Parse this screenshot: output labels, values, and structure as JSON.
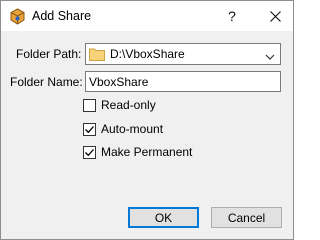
{
  "window": {
    "title": "Add Share",
    "help_glyph": "?",
    "icons": {
      "app": "virtualbox-app-icon",
      "close": "close-icon"
    }
  },
  "form": {
    "folder_path": {
      "label": "Folder Path:",
      "value": "D:\\VboxShare",
      "icon": "folder-icon"
    },
    "folder_name": {
      "label": "Folder Name:",
      "value": "VboxShare"
    },
    "options": [
      {
        "label": "Read-only",
        "checked": false
      },
      {
        "label": "Auto-mount",
        "checked": true
      },
      {
        "label": "Make Permanent",
        "checked": true
      }
    ]
  },
  "buttons": {
    "ok": "OK",
    "cancel": "Cancel"
  },
  "colors": {
    "dialog_bg": "#f0f0f0",
    "title_bg": "#ffffff",
    "default_button_border": "#0078d7",
    "folder_icon": "#f7d27a"
  }
}
